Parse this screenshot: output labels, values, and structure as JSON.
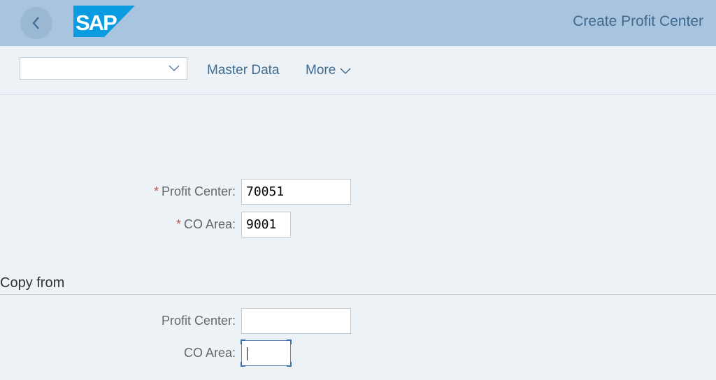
{
  "header": {
    "back_icon": "chevron-left-icon",
    "logo_text": "SAP",
    "title": "Create Profit Center",
    "colors": {
      "bar": "#a9c4de",
      "title": "#3f6a91",
      "logo": "#0a9be0"
    }
  },
  "toolbar": {
    "combo_value": "",
    "combo_icon": "chevron-down-icon",
    "links": [
      {
        "label": "Master Data"
      },
      {
        "label": "More",
        "icon": "chevron-down-icon"
      }
    ]
  },
  "form": {
    "required_marker": "*",
    "fields": [
      {
        "label": "Profit Center:",
        "value": "70051",
        "required": true
      },
      {
        "label": "CO Area:",
        "value": "9001",
        "required": true
      }
    ]
  },
  "copy_from": {
    "title": "Copy from",
    "fields": [
      {
        "label": "Profit Center:",
        "value": ""
      },
      {
        "label": "CO Area:",
        "value": "",
        "focused": true
      }
    ]
  }
}
